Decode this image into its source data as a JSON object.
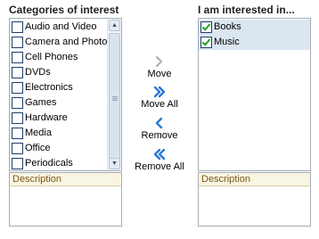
{
  "left_panel": {
    "title": "Categories of interest",
    "items": [
      {
        "label": "Audio and Video",
        "checked": false
      },
      {
        "label": "Camera and Photo",
        "checked": false
      },
      {
        "label": "Cell Phones",
        "checked": false
      },
      {
        "label": "DVDs",
        "checked": false
      },
      {
        "label": "Electronics",
        "checked": false
      },
      {
        "label": "Games",
        "checked": false
      },
      {
        "label": "Hardware",
        "checked": false
      },
      {
        "label": "Media",
        "checked": false
      },
      {
        "label": "Office",
        "checked": false
      },
      {
        "label": "Periodicals",
        "checked": false
      }
    ],
    "description_label": "Description"
  },
  "right_panel": {
    "title": "I am interested in...",
    "items": [
      {
        "label": "Books",
        "checked": true
      },
      {
        "label": "Music",
        "checked": true
      }
    ],
    "description_label": "Description"
  },
  "actions": {
    "move": {
      "label": "Move",
      "icon": "chevron-right-icon",
      "enabled": false
    },
    "move_all": {
      "label": "Move All",
      "icon": "double-chevron-right-icon",
      "enabled": true
    },
    "remove": {
      "label": "Remove",
      "icon": "chevron-left-icon",
      "enabled": true
    },
    "remove_all": {
      "label": "Remove All",
      "icon": "double-chevron-left-icon",
      "enabled": true
    }
  },
  "colors": {
    "accent": "#2a7ad6",
    "disabled": "#b0b0b0",
    "selected_row": "#dce6f0",
    "check": "#21a121"
  }
}
